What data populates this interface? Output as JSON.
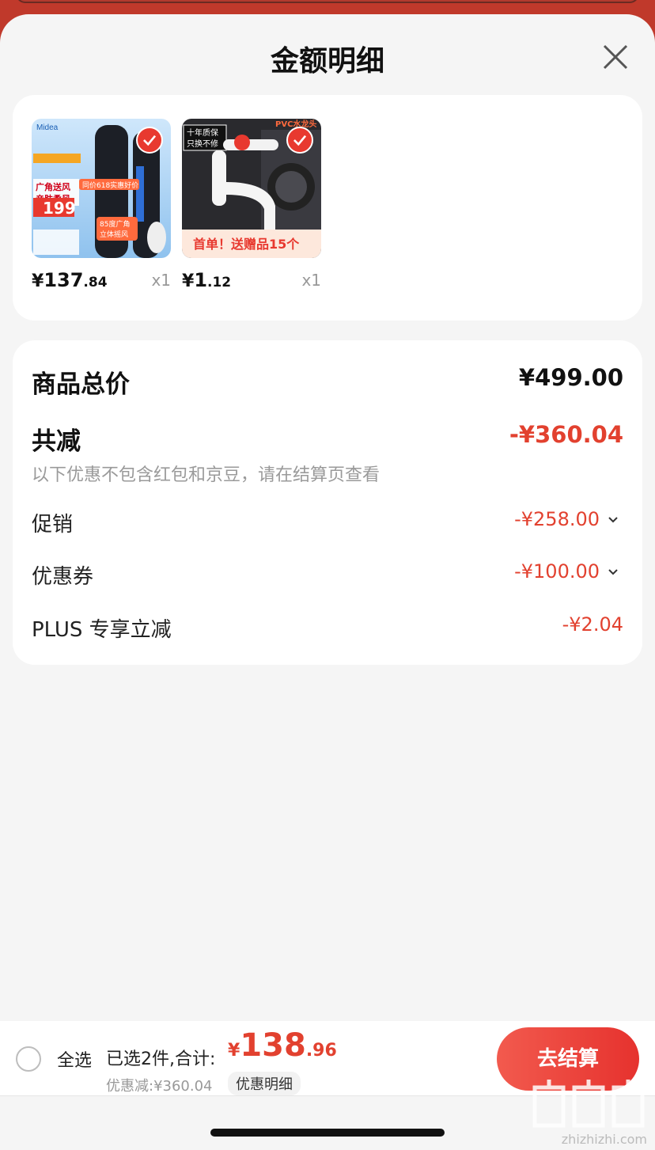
{
  "sheet": {
    "title": "金额明细"
  },
  "products": [
    {
      "name": "Midea tower fan",
      "currency": "¥",
      "price_int": "137",
      "price_dec": ".84",
      "qty": "x1",
      "thumb_texts": {
        "brand": "Midea",
        "line1": "广角送风",
        "line2": "亲肤柔风",
        "promo": "同价618实惠好价",
        "price": "199",
        "angle": "85度广角",
        "angle2": "立体摇风"
      }
    },
    {
      "name": "PVC faucet",
      "currency": "¥",
      "price_int": "1",
      "price_dec": ".12",
      "qty": "x1",
      "thumb_texts": {
        "tag": "PVC水龙头",
        "warranty1": "十年质保",
        "warranty2": "只换不修",
        "banner": "首单！送赠品15个"
      }
    }
  ],
  "summary": {
    "total_label": "商品总价",
    "total_value": "¥499.00",
    "reduce_label": "共减",
    "reduce_value": "-¥360.04",
    "note": "以下优惠不包含红包和京豆，请在结算页查看",
    "promo_label": "促销",
    "promo_value": "-¥258.00",
    "coupon_label": "优惠券",
    "coupon_value": "-¥100.00",
    "plus_label": "PLUS 专享立减",
    "plus_value": "-¥2.04"
  },
  "bottom": {
    "select_all": "全选",
    "selected_text": "已选2件,合计:",
    "currency": "¥",
    "grand_int": "138",
    "grand_dec": ".96",
    "discount_text": "优惠减:¥360.04",
    "detail_link": "优惠明细",
    "checkout": "去结算"
  },
  "watermark": {
    "text": "zhizhizhi.com"
  },
  "colors": {
    "accent": "#e2412f",
    "backdrop": "#c0392b",
    "sheet_bg": "#f5f5f5"
  }
}
